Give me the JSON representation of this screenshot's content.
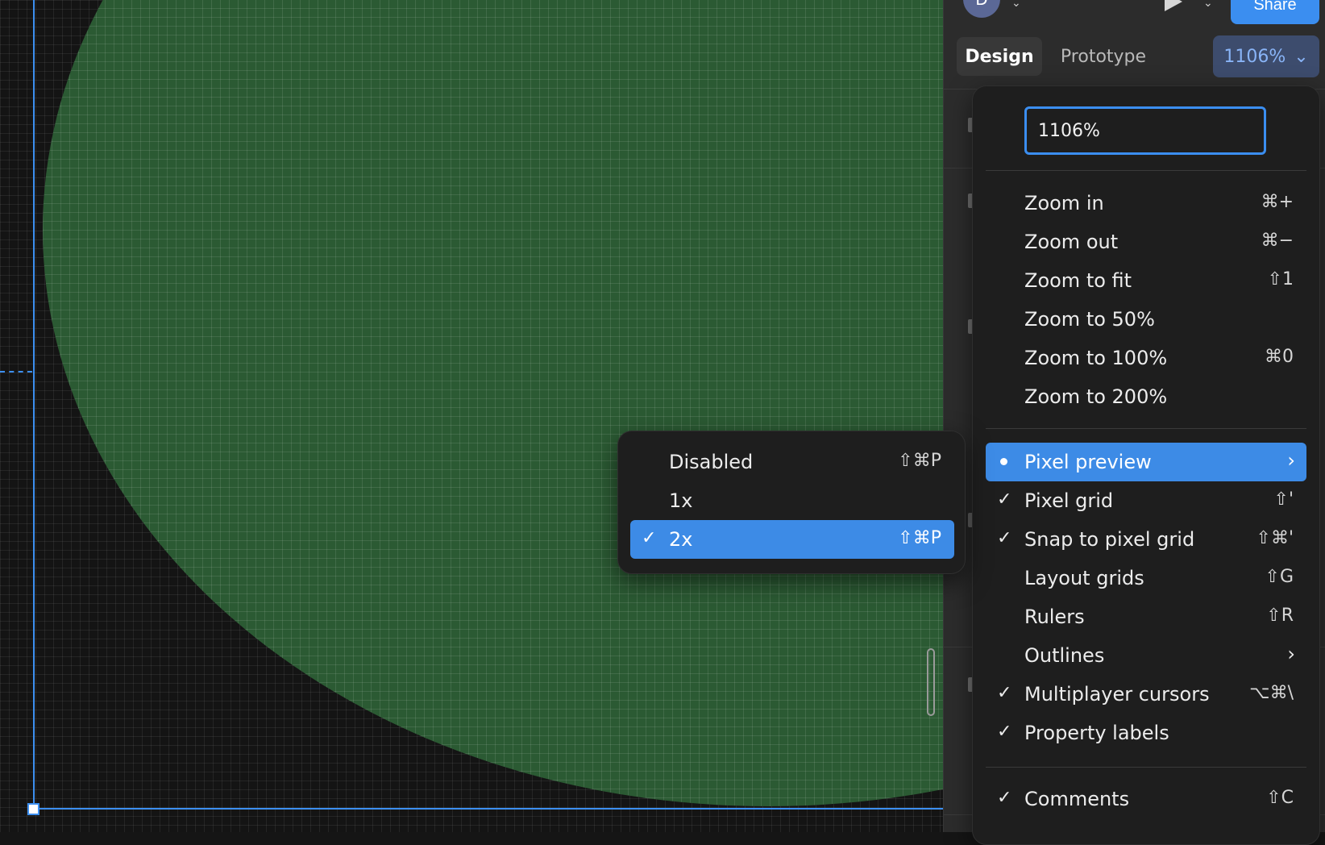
{
  "header": {
    "avatar_initial": "D",
    "share_label": "Share",
    "tabs": {
      "design": "Design",
      "prototype": "Prototype"
    },
    "zoom_value": "1106%",
    "zoom_chevron": "⌄"
  },
  "zoom_menu": {
    "input_value": "1106%",
    "items": [
      {
        "label": "Zoom in",
        "shortcut": "⌘+"
      },
      {
        "label": "Zoom out",
        "shortcut": "⌘−"
      },
      {
        "label": "Zoom to fit",
        "shortcut": "⇧1"
      },
      {
        "label": "Zoom to 50%",
        "shortcut": ""
      },
      {
        "label": "Zoom to 100%",
        "shortcut": "⌘0"
      },
      {
        "label": "Zoom to 200%",
        "shortcut": ""
      },
      {
        "label": "Pixel preview",
        "shortcut": ""
      },
      {
        "label": "Pixel grid",
        "shortcut": "⇧'"
      },
      {
        "label": "Snap to pixel grid",
        "shortcut": "⇧⌘'"
      },
      {
        "label": "Layout grids",
        "shortcut": "⇧G"
      },
      {
        "label": "Rulers",
        "shortcut": "⇧R"
      },
      {
        "label": "Outlines",
        "shortcut": ""
      },
      {
        "label": "Multiplayer cursors",
        "shortcut": "⌥⌘\\"
      },
      {
        "label": "Property labels",
        "shortcut": ""
      },
      {
        "label": "Comments",
        "shortcut": "⇧C"
      }
    ],
    "chevron": "›",
    "check": "✓"
  },
  "pixel_submenu": {
    "items": [
      {
        "label": "Disabled",
        "shortcut": "⇧⌘P"
      },
      {
        "label": "1x",
        "shortcut": ""
      },
      {
        "label": "2x",
        "shortcut": "⇧⌘P"
      }
    ]
  },
  "colors": {
    "accent": "#3b8ef0",
    "menu_bg": "#1e1e1e",
    "canvas_bg": "#141414",
    "shape_fill": "#2b5a33"
  }
}
